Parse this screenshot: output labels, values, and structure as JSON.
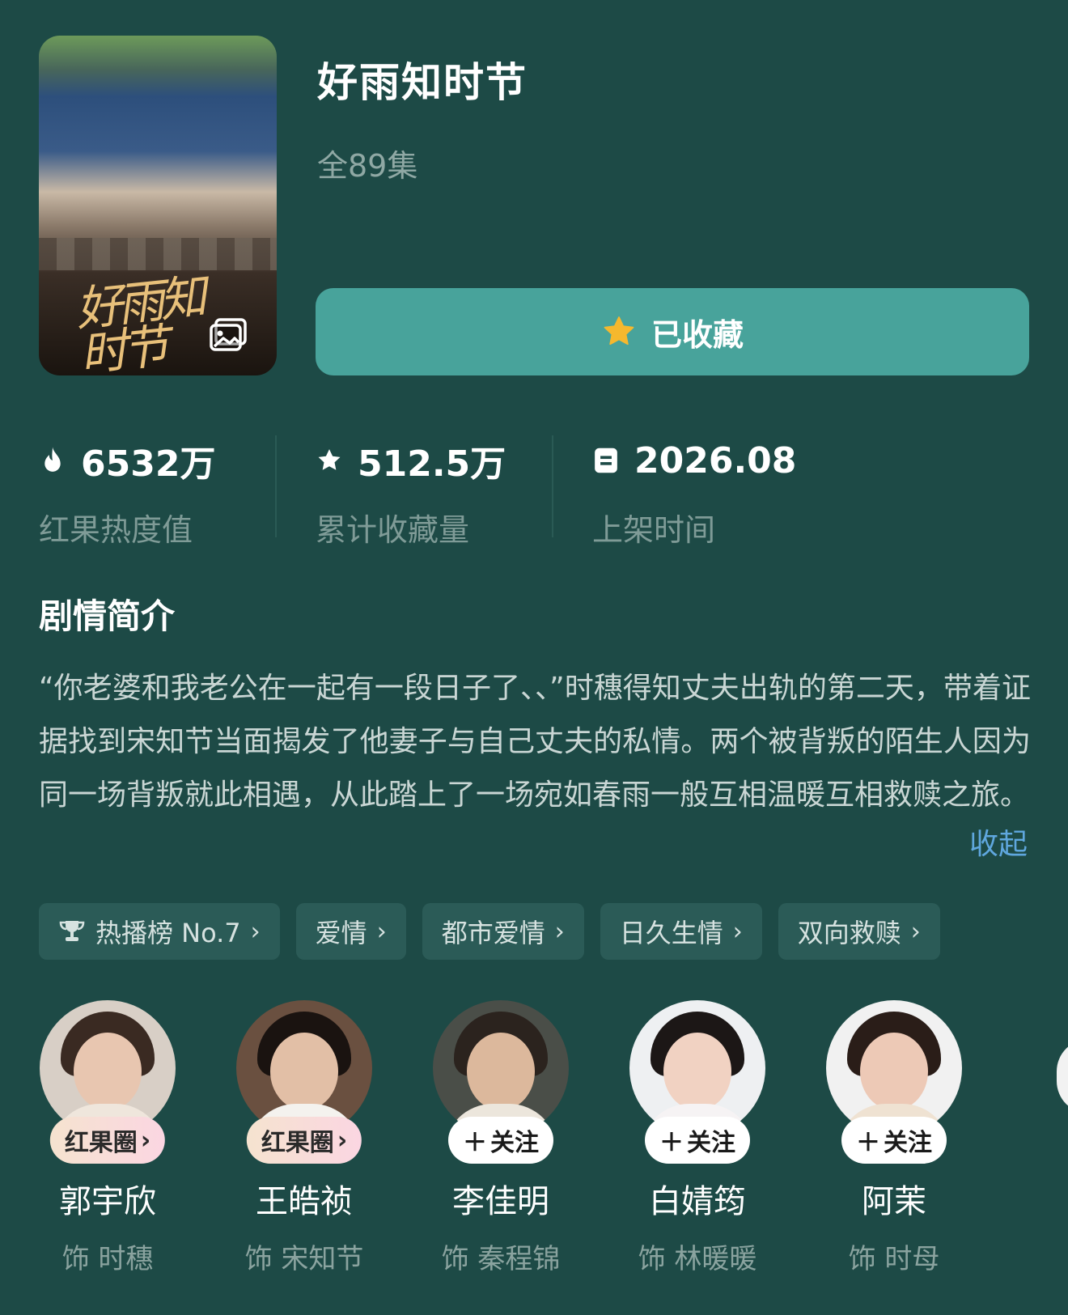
{
  "drama": {
    "title": "好雨知时节",
    "episodes": "全89集",
    "poster_text": "好雨知时节",
    "favorite_label": "已收藏"
  },
  "stats": [
    {
      "icon": "flame-icon",
      "value": "6532万",
      "label": "红果热度值"
    },
    {
      "icon": "star-icon",
      "value": "512.5万",
      "label": "累计收藏量"
    },
    {
      "icon": "calendar-icon",
      "value": "2026.08",
      "label": "上架时间"
    }
  ],
  "synopsis": {
    "heading": "剧情简介",
    "text": "“你老婆和我老公在一起有一段日子了、、”时穗得知丈夫出轨的第二天，带着证据找到宋知节当面揭发了他妻子与自己丈夫的私情。两个被背叛的陌生人因为同一场背叛就此相遇，从此踏上了一场宛如春雨一般互相温暖互相救赎之旅。",
    "collapse_label": "收起"
  },
  "tags": [
    {
      "label": "热播榜 No.7",
      "icon": "trophy-icon"
    },
    {
      "label": "爱情"
    },
    {
      "label": "都市爱情"
    },
    {
      "label": "日久生情"
    },
    {
      "label": "双向救赎"
    }
  ],
  "cast": [
    {
      "name": "郭宇欣",
      "role": "饰 时穗",
      "badge": "红果圈",
      "badge_type": "circle"
    },
    {
      "name": "王皓祯",
      "role": "饰 宋知节",
      "badge": "红果圈",
      "badge_type": "circle"
    },
    {
      "name": "李佳明",
      "role": "饰 秦程锦",
      "badge": "关注",
      "badge_type": "follow"
    },
    {
      "name": "白婧筠",
      "role": "饰 林暖暖",
      "badge": "关注",
      "badge_type": "follow"
    },
    {
      "name": "阿茉",
      "role": "饰 时母",
      "badge": "关注",
      "badge_type": "follow"
    }
  ],
  "colors": {
    "background": "#1d4a46",
    "favorite_button": "#48a39b",
    "star": "#f5b82e",
    "tag_background": "#2b5b57",
    "link": "#5fa7de"
  }
}
